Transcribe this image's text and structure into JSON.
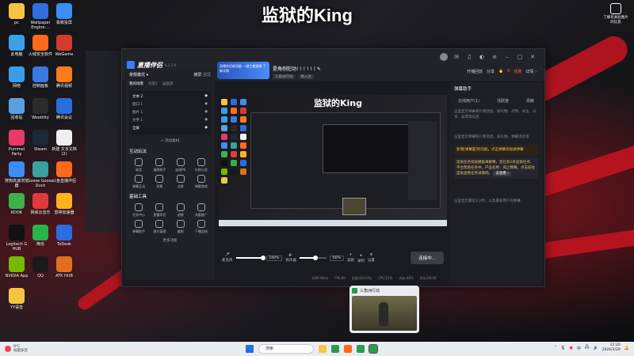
{
  "wallpaper": {
    "title": "监狱的King"
  },
  "desktop_icons_left": [
    {
      "label": "pc",
      "color": "#f5c542"
    },
    {
      "label": "Wallpaper Engine:...",
      "color": "#2f6de0"
    },
    {
      "label": "极致投屏",
      "color": "#3a8ef5"
    },
    {
      "label": "此电脑",
      "color": "#3aa0e8"
    },
    {
      "label": "火绒安全软件",
      "color": "#ff6a1a"
    },
    {
      "label": "WeGame",
      "color": "#d63a2a"
    },
    {
      "label": "网络",
      "color": "#3a9de8"
    },
    {
      "label": "控制面板",
      "color": "#3a7ae0"
    },
    {
      "label": "腾讯视频",
      "color": "#ff7a1a"
    },
    {
      "label": "回收站",
      "color": "#5aa0e0"
    },
    {
      "label": "Wootility",
      "color": "#2b2b2b"
    },
    {
      "label": "腾讯会议",
      "color": "#2a6de0"
    },
    {
      "label": "Pummel Party",
      "color": "#e53a6a"
    },
    {
      "label": "Steam",
      "color": "#1b2838"
    },
    {
      "label": "新建 文本文档 (2)",
      "color": "#eeeeee"
    },
    {
      "label": "搜狗高速浏览器",
      "color": "#3a8ef5"
    },
    {
      "label": "Goose Goose Duck",
      "color": "#3aa0a0"
    },
    {
      "label": "斗鱼直播伴侣",
      "color": "#ff6a1a"
    },
    {
      "label": "KOOK",
      "color": "#3bb34a"
    },
    {
      "label": "网易云音乐",
      "color": "#e03a3a"
    },
    {
      "label": "雷神加速器",
      "color": "#ffb31a"
    },
    {
      "label": "Logitech G HUB",
      "color": "#111111"
    },
    {
      "label": "微信",
      "color": "#2bb24a"
    },
    {
      "label": "ToDesk",
      "color": "#2a6de0"
    },
    {
      "label": "NVIDIA App",
      "color": "#76b900"
    },
    {
      "label": "QQ",
      "color": "#1a1a1a"
    },
    {
      "label": "ATK HUB",
      "color": "#e0701a"
    },
    {
      "label": "YY语音",
      "color": "#f5c542"
    }
  ],
  "desktop_icon_right": {
    "label": "了解有关此图片的信息"
  },
  "app": {
    "name": "直播伴侣",
    "version": "6.3.7.4",
    "banner_text": "直播伴侣新功能 一键主播直播 了解详情",
    "room_title": "是角例犯动! ! ! ! ! !",
    "category": "三角洲行动",
    "room_action": "换入主",
    "open_live": "开播回放",
    "share": "分享",
    "setup": "设置",
    "stats": [
      "全站榜",
      "4",
      "0"
    ],
    "hot_count": "0",
    "hot_label": "热度",
    "detail": "详情 ›"
  },
  "left_panel": {
    "mode": "常规模式 ▾",
    "switch": "横屏",
    "switch2": "竖屏",
    "tabs": [
      "我的场景",
      "场景2",
      "画面源"
    ],
    "scenes": [
      {
        "name": "文本 2",
        "active": true
      },
      {
        "name": "窗口 1",
        "active": false
      },
      {
        "name": "图片 1",
        "active": false
      },
      {
        "name": "文字 1",
        "active": false
      },
      {
        "name": "全屏",
        "active": true
      }
    ],
    "add_source": "+ 添加素材",
    "interactive_title": "互动玩法",
    "interactive_items": [
      "抽奖",
      "福袋助手",
      "连线PK",
      "礼物心愿",
      "弹幕互动",
      "投票",
      "点歌",
      "弹幕游戏"
    ],
    "tools_title": "基础工具",
    "tools_items": [
      "任务中心",
      "直播伴侣",
      "滤镜",
      "流量推广",
      "弹幕助手",
      "观众管理",
      "美颜",
      "下播总结"
    ],
    "more": "更多功能"
  },
  "preview": {
    "title": "监狱的King"
  },
  "controls": {
    "mic_label": "麦克风",
    "mic_pct": "100%",
    "mic_level": 1.0,
    "speaker_label": "扬声器",
    "speaker_pct": "60%",
    "speaker_level": 0.6,
    "buttons": [
      "美颜",
      "录制",
      "设置"
    ],
    "live_button": "连接中..."
  },
  "status": [
    "码率:0kb/s",
    "FPS:60",
    "丢帧:0(0.0%)",
    "CPU:21%",
    "内存:46%",
    "时长:00:00"
  ],
  "right_panel": {
    "header": "弹幕助手",
    "tabs": [
      "在线用户(1)",
      "活跃度",
      "贡献"
    ],
    "intro": "这里显示弹幕和礼物消息，如礼物、点赞、关注、分享、投票等信息",
    "gift_text": "这里显示弹幕和礼物消息，如礼物、弹幕消息等",
    "notice1": "新增[弹幕置顶]功能。点击弹幕添加进弹幕",
    "notice2": "是角任务奖励模板来解释，您已有1条是角任务、平台帮助任务中。产品名称：风之锦舞。点击前往是角查看任务详情吧。",
    "notice_link": "去查看 ›",
    "footer": "这里显示最近2小时，以及最新用户的弹幕"
  },
  "popup": {
    "title": "三角洲行动"
  },
  "taskbar": {
    "weather_temp": "9°C",
    "weather_desc": "局部多云",
    "search": "搜索",
    "time": "22:20",
    "date": "2026/3/29",
    "lang": "中"
  }
}
